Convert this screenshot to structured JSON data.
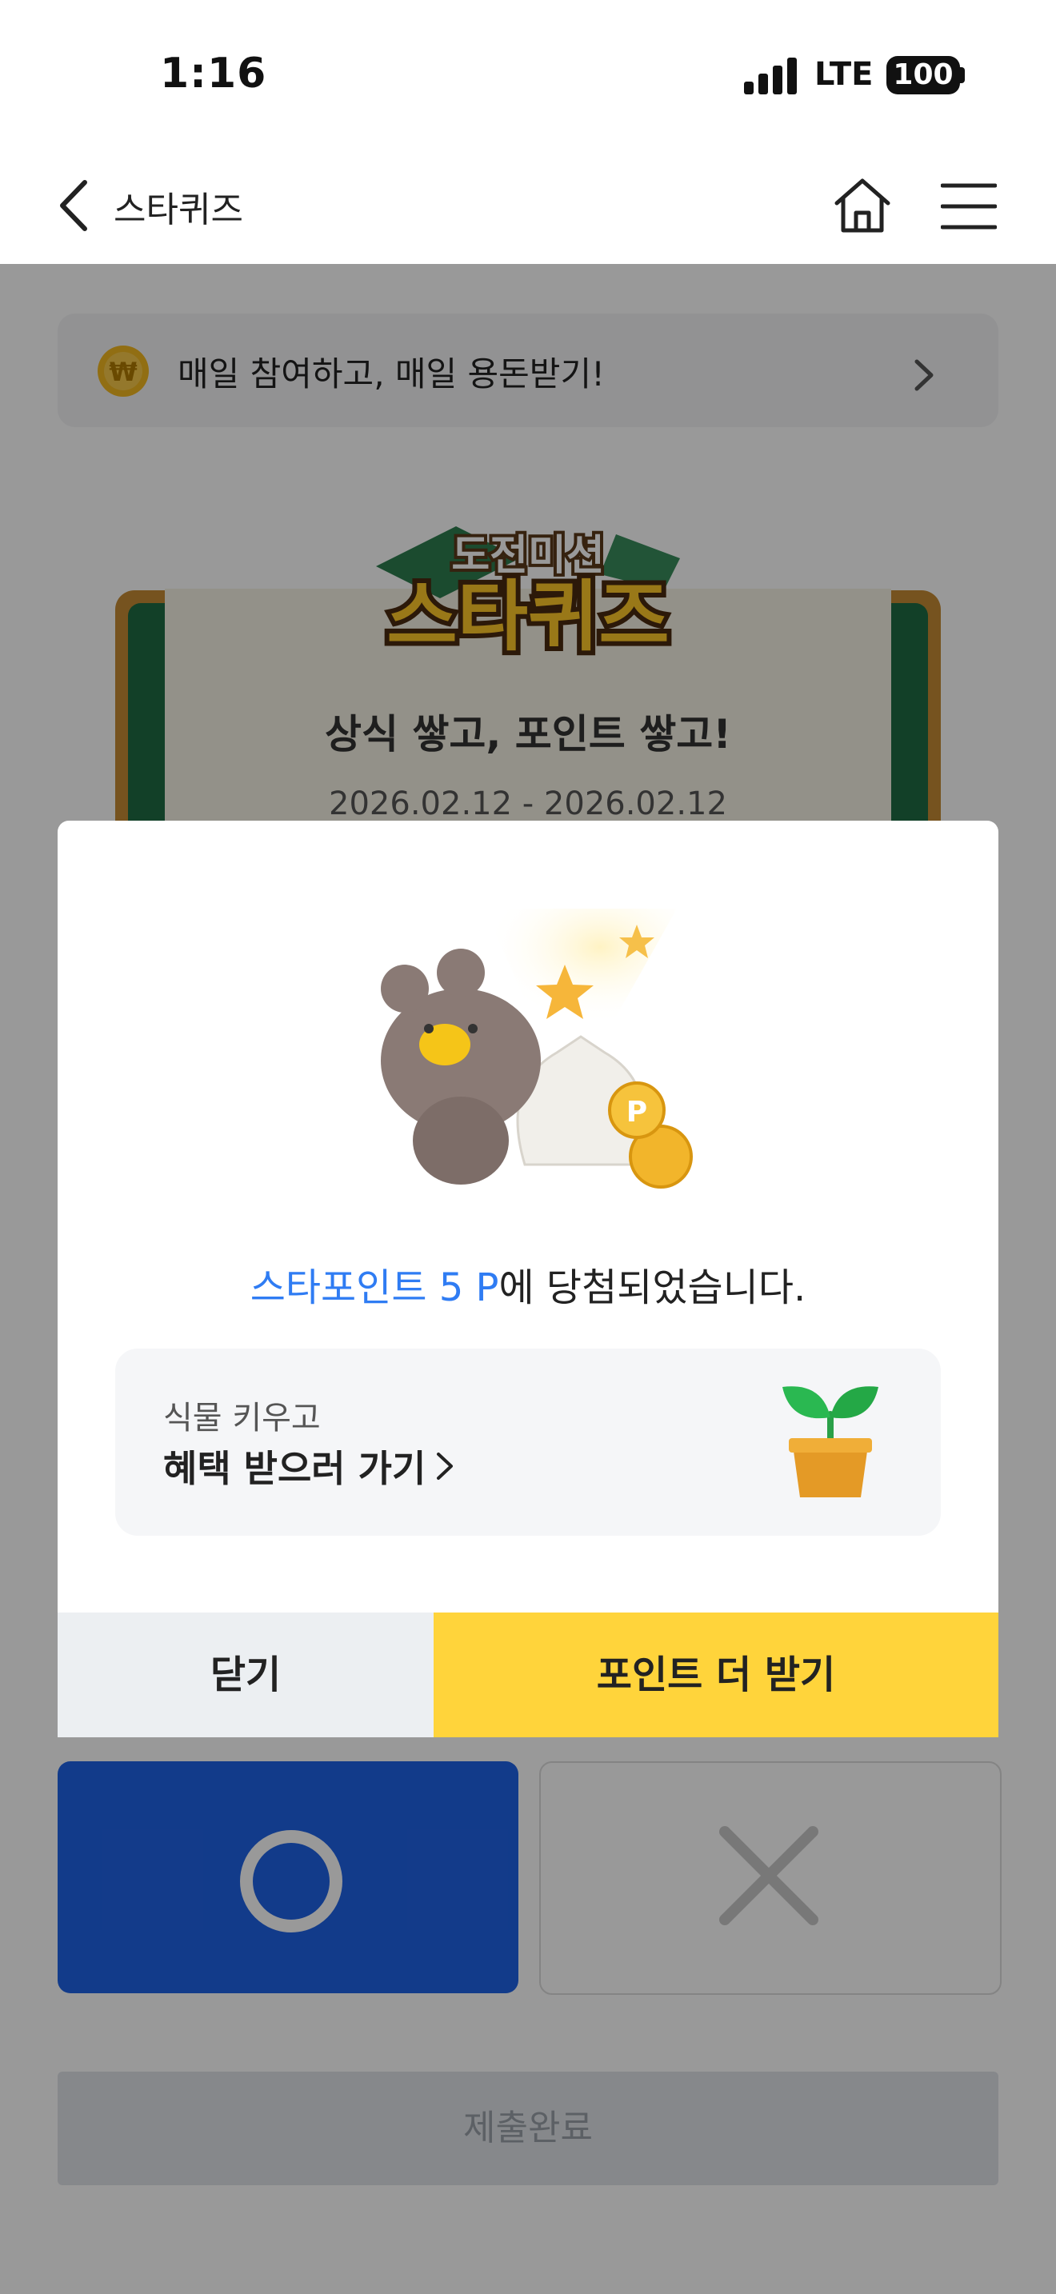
{
  "status_bar": {
    "time": "1:16",
    "network": "LTE",
    "battery": "100"
  },
  "nav": {
    "title": "스타퀴즈",
    "back_icon": "chevron-left-icon",
    "home_icon": "home-icon",
    "menu_icon": "hamburger-menu-icon"
  },
  "notice": {
    "text": "매일 참여하고, 매일 용돈받기!",
    "icon": "won-coin-icon",
    "arrow_icon": "chevron-right-icon"
  },
  "quiz_card": {
    "logo_top": "도전미션",
    "logo_main": "스타퀴즈",
    "slogan": "상식 쌓고, 포인트 쌓고!",
    "dates": "2026.02.12 - 2026.02.12"
  },
  "answers": {
    "o_icon": "circle-o-icon",
    "x_icon": "x-mark-icon"
  },
  "submit_label": "제출완료",
  "modal": {
    "win_accent": "스타포인트 5 P",
    "win_rest": "에 당첨되었습니다.",
    "promo_sub": "식물 키우고",
    "promo_main": "혜택 받으러 가기",
    "promo_icon": "potted-plant-icon",
    "close_label": "닫기",
    "more_label": "포인트 더 받기"
  },
  "colors": {
    "accent_blue": "#2f7cf3",
    "yellow": "#ffd43b",
    "o_blue": "#1f63e6"
  }
}
